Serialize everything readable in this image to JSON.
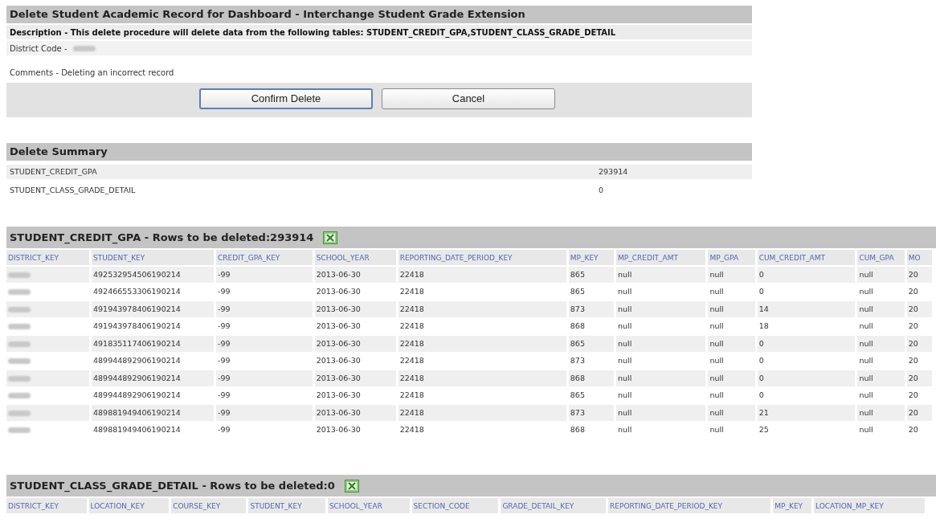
{
  "form": {
    "title": "Delete Student Academic Record for Dashboard - Interchange Student Grade Extension",
    "description": "Description - This delete procedure will delete data from the following tables: STUDENT_CREDIT_GPA,STUDENT_CLASS_GRADE_DETAIL",
    "district_label": "District Code -",
    "comments": "Comments - Deleting an incorrect record",
    "buttons": [
      {
        "label": "Confirm Delete",
        "focused": true
      },
      {
        "label": "Cancel",
        "focused": false
      }
    ]
  },
  "summary": {
    "title": "Delete Summary",
    "rows": [
      {
        "table": "STUDENT_CREDIT_GPA",
        "count": "293914"
      },
      {
        "table": "STUDENT_CLASS_GRADE_DETAIL",
        "count": "0"
      }
    ]
  },
  "tables": [
    {
      "title": "STUDENT_CREDIT_GPA - Rows to be deleted:293914",
      "columns": [
        "DISTRICT_KEY",
        "STUDENT_KEY",
        "CREDIT_GPA_KEY",
        "SCHOOL_YEAR",
        "REPORTING_DATE_PERIOD_KEY",
        "MP_KEY",
        "MP_CREDIT_AMT",
        "MP_GPA",
        "CUM_CREDIT_AMT",
        "CUM_GPA",
        "MO"
      ],
      "rows": [
        [
          "",
          "492532954506190214",
          "-99",
          "2013-06-30",
          "22418",
          "865",
          "null",
          "null",
          "0",
          "null",
          "20"
        ],
        [
          "",
          "492466553306190214",
          "-99",
          "2013-06-30",
          "22418",
          "865",
          "null",
          "null",
          "0",
          "null",
          "20"
        ],
        [
          "",
          "491943978406190214",
          "-99",
          "2013-06-30",
          "22418",
          "873",
          "null",
          "null",
          "14",
          "null",
          "20"
        ],
        [
          "",
          "491943978406190214",
          "-99",
          "2013-06-30",
          "22418",
          "868",
          "null",
          "null",
          "18",
          "null",
          "20"
        ],
        [
          "",
          "491835117406190214",
          "-99",
          "2013-06-30",
          "22418",
          "865",
          "null",
          "null",
          "0",
          "null",
          "20"
        ],
        [
          "",
          "489944892906190214",
          "-99",
          "2013-06-30",
          "22418",
          "873",
          "null",
          "null",
          "0",
          "null",
          "20"
        ],
        [
          "",
          "489944892906190214",
          "-99",
          "2013-06-30",
          "22418",
          "868",
          "null",
          "null",
          "0",
          "null",
          "20"
        ],
        [
          "",
          "489944892906190214",
          "-99",
          "2013-06-30",
          "22418",
          "865",
          "null",
          "null",
          "0",
          "null",
          "20"
        ],
        [
          "",
          "489881949406190214",
          "-99",
          "2013-06-30",
          "22418",
          "873",
          "null",
          "null",
          "21",
          "null",
          "20"
        ],
        [
          "",
          "489881949406190214",
          "-99",
          "2013-06-30",
          "22418",
          "868",
          "null",
          "null",
          "25",
          "null",
          "20"
        ]
      ]
    },
    {
      "title": "STUDENT_CLASS_GRADE_DETAIL - Rows to be deleted:0",
      "columns": [
        "DISTRICT_KEY",
        "LOCATION_KEY",
        "COURSE_KEY",
        "STUDENT_KEY",
        "SCHOOL_YEAR",
        "SECTION_CODE",
        "GRADE_DETAIL_KEY",
        "REPORTING_DATE_PERIOD_KEY",
        "MP_KEY",
        "LOCATION_MP_KEY"
      ]
    }
  ]
}
